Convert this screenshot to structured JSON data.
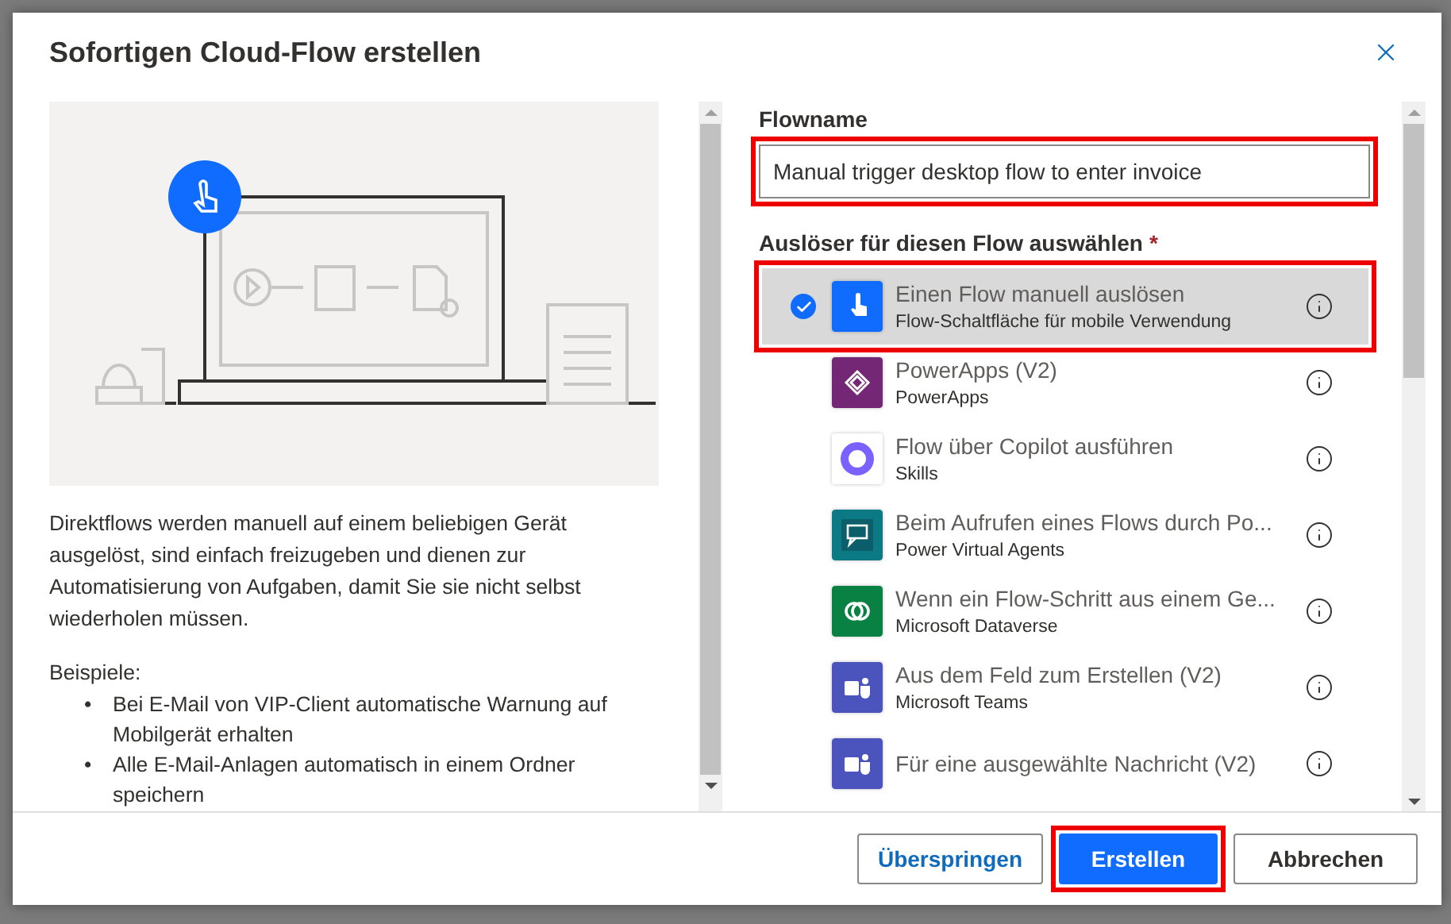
{
  "dialog": {
    "title": "Sofortigen Cloud-Flow erstellen"
  },
  "description": "Direktflows werden manuell auf einem beliebigen Gerät ausgelöst, sind einfach freizugeben und dienen zur Automatisierung von Aufgaben, damit Sie sie nicht selbst wiederholen müssen.",
  "examples": {
    "heading": "Beispiele:",
    "bullet": "•",
    "items": [
      "Bei E-Mail von VIP-Client automatische Warnung auf Mobilgerät erhalten",
      "Alle E-Mail-Anlagen automatisch in einem Ordner speichern"
    ]
  },
  "flow_name": {
    "label": "Flowname",
    "value": "Manual trigger desktop flow to enter invoice",
    "highlighted": true
  },
  "trigger_section": {
    "label": "Auslöser für diesen Flow auswählen",
    "required_mark": "*"
  },
  "triggers": [
    {
      "kind": "manual",
      "color": "#0f6cff",
      "title": "Einen Flow manuell auslösen",
      "subtitle": "Flow-Schaltfläche für mobile Verwendung",
      "selected": true,
      "highlighted": true
    },
    {
      "kind": "powerapps",
      "color": "#742774",
      "title": "PowerApps (V2)",
      "subtitle": "PowerApps",
      "selected": false,
      "highlighted": false
    },
    {
      "kind": "copilot",
      "color": "#ffffff",
      "title": "Flow über Copilot ausführen",
      "subtitle": "Skills",
      "selected": false,
      "highlighted": false
    },
    {
      "kind": "chatbot",
      "color": "#0b7a85",
      "title": "Beim Aufrufen eines Flows durch Po...",
      "subtitle": "Power Virtual Agents",
      "selected": false,
      "highlighted": false
    },
    {
      "kind": "dataverse",
      "color": "#088142",
      "title": "Wenn ein Flow-Schritt aus einem Ge...",
      "subtitle": "Microsoft Dataverse",
      "selected": false,
      "highlighted": false
    },
    {
      "kind": "teams",
      "color": "#4b53bc",
      "title": "Aus dem Feld zum Erstellen (V2)",
      "subtitle": "Microsoft Teams",
      "selected": false,
      "highlighted": false
    },
    {
      "kind": "teams",
      "color": "#4b53bc",
      "title": "Für eine ausgewählte Nachricht (V2)",
      "selected": false,
      "highlighted": false
    }
  ],
  "buttons": [
    {
      "kind": "link",
      "label": "Überspringen",
      "highlighted": false
    },
    {
      "kind": "primary",
      "label": "Erstellen",
      "highlighted": true
    },
    {
      "kind": "default",
      "label": "Abbrechen",
      "highlighted": false
    }
  ]
}
